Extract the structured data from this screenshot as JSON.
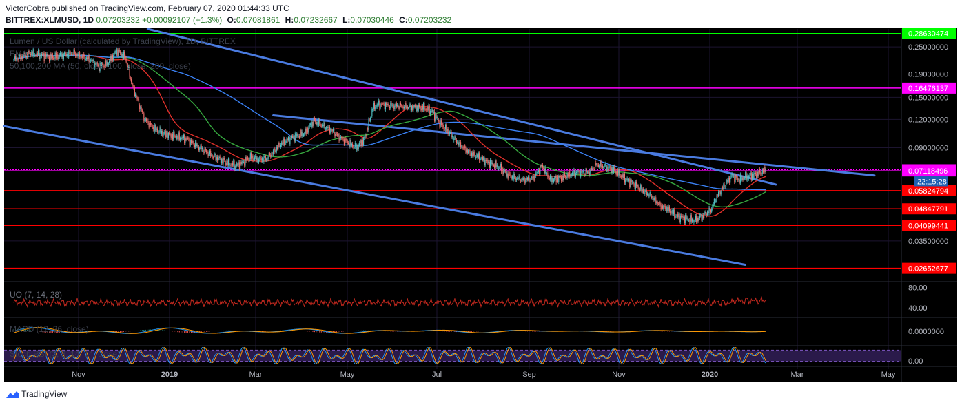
{
  "header": {
    "line1": "VictorCobra published on TradingView.com, February 07, 2020 01:44:33 UTC",
    "symbol": "BITTREX:XLMUSD, 1D",
    "price": "0.07203232",
    "change": "+0.00092107 (+1.3%)",
    "o_label": "O:",
    "o": "0.07081861",
    "h_label": "H:",
    "h": "0.07232667",
    "l_label": "L:",
    "l": "0.07030446",
    "c_label": "C:",
    "c": "0.07203232"
  },
  "legend": {
    "main": "Lumen / US Dollar (calculated by TradingView), 1D, BITTREX",
    "emas": "EMA",
    "mas": "50,100,200 MA (50, close, 100, close, 200, close)",
    "uo": "UO (7, 14, 28)",
    "macd": "MACD (12, 26, close)",
    "stoch": "Stoch RSI (3, 3, 14, 14, close)"
  },
  "footer": {
    "brand": "TradingView"
  },
  "colors": {
    "bg": "#000000",
    "grid": "#1c1430",
    "axis_text": "#b2b5be",
    "candle_up": "#4fc1c4",
    "candle_down": "#ef6f6c",
    "trendline": "#4a7be0",
    "ma50": "#e0302a",
    "ma100": "#36a83f",
    "ma200": "#3b82f6",
    "level_green": "#00ff00",
    "level_magenta": "#ff00ff",
    "level_red": "#ff0000"
  },
  "chart_data": [
    {
      "type": "candlestick",
      "title": "Lumen / US Dollar (calculated by TradingView), 1D, BITTREX",
      "scale": "log",
      "ylim": [
        0.0235,
        0.3
      ],
      "x_tick_labels": [
        "Nov",
        "2019",
        "Mar",
        "May",
        "Jul",
        "Sep",
        "Nov",
        "2020",
        "Mar",
        "May"
      ],
      "y_tick_labels": [
        0.25,
        0.19,
        0.15,
        0.12,
        0.09,
        0.05824794,
        0.035,
        0.02652677
      ],
      "close_path": [
        [
          0,
          0.22
        ],
        [
          20,
          0.235
        ],
        [
          45,
          0.225
        ],
        [
          70,
          0.235
        ],
        [
          90,
          0.22
        ],
        [
          100,
          0.205
        ],
        [
          110,
          0.21
        ],
        [
          122,
          0.24
        ],
        [
          132,
          0.225
        ],
        [
          140,
          0.17
        ],
        [
          148,
          0.14
        ],
        [
          155,
          0.12
        ],
        [
          165,
          0.11
        ],
        [
          175,
          0.105
        ],
        [
          185,
          0.102
        ],
        [
          205,
          0.098
        ],
        [
          220,
          0.09
        ],
        [
          235,
          0.083
        ],
        [
          250,
          0.078
        ],
        [
          262,
          0.075
        ],
        [
          270,
          0.077
        ],
        [
          280,
          0.082
        ],
        [
          290,
          0.08
        ],
        [
          300,
          0.081
        ],
        [
          315,
          0.093
        ],
        [
          330,
          0.1
        ],
        [
          345,
          0.105
        ],
        [
          355,
          0.118
        ],
        [
          365,
          0.113
        ],
        [
          375,
          0.108
        ],
        [
          385,
          0.1
        ],
        [
          395,
          0.095
        ],
        [
          405,
          0.09
        ],
        [
          415,
          0.098
        ],
        [
          425,
          0.135
        ],
        [
          432,
          0.14
        ],
        [
          445,
          0.138
        ],
        [
          460,
          0.137
        ],
        [
          475,
          0.135
        ],
        [
          485,
          0.135
        ],
        [
          495,
          0.13
        ],
        [
          505,
          0.115
        ],
        [
          515,
          0.105
        ],
        [
          525,
          0.095
        ],
        [
          540,
          0.085
        ],
        [
          550,
          0.082
        ],
        [
          560,
          0.078
        ],
        [
          575,
          0.074
        ],
        [
          585,
          0.068
        ],
        [
          595,
          0.066
        ],
        [
          605,
          0.065
        ],
        [
          615,
          0.066
        ],
        [
          625,
          0.075
        ],
        [
          635,
          0.065
        ],
        [
          645,
          0.066
        ],
        [
          655,
          0.068
        ],
        [
          665,
          0.07
        ],
        [
          680,
          0.07
        ],
        [
          690,
          0.076
        ],
        [
          700,
          0.074
        ],
        [
          710,
          0.072
        ],
        [
          725,
          0.065
        ],
        [
          735,
          0.062
        ],
        [
          745,
          0.058
        ],
        [
          755,
          0.055
        ],
        [
          765,
          0.05
        ],
        [
          775,
          0.048
        ],
        [
          785,
          0.045
        ],
        [
          795,
          0.044
        ],
        [
          805,
          0.043
        ],
        [
          815,
          0.045
        ],
        [
          825,
          0.048
        ],
        [
          832,
          0.055
        ],
        [
          842,
          0.062
        ],
        [
          850,
          0.068
        ],
        [
          858,
          0.065
        ],
        [
          866,
          0.067
        ],
        [
          874,
          0.068
        ],
        [
          884,
          0.07
        ],
        [
          890,
          0.07203232
        ]
      ],
      "overlay_levels": [
        {
          "value": 0.28630474,
          "label": "0.28630474",
          "color": "level_green"
        },
        {
          "value": 0.16476137,
          "label": "0.16476137",
          "color": "level_magenta"
        },
        {
          "value": 0.07203232,
          "label": "0.07203232",
          "color": "level_magenta",
          "style": "dotted"
        },
        {
          "value": 0.07118496,
          "label": "0.07118496",
          "color": "level_magenta"
        },
        {
          "value": 0.05824794,
          "label": "0.05824794",
          "color": "level_red"
        },
        {
          "value": 0.04847791,
          "label": "0.04847791",
          "color": "level_red"
        },
        {
          "value": 0.04099441,
          "label": "0.04099441",
          "color": "level_red"
        },
        {
          "value": 0.02652677,
          "label": "0.02652677",
          "color": "level_red"
        }
      ],
      "countdown": "22:15:28",
      "trendlines": [
        {
          "from": [
            0.16,
            0.3
          ],
          "to": [
            0.86,
            0.062
          ]
        },
        {
          "from": [
            0,
            0.112
          ],
          "to": [
            0.826,
            0.0275
          ]
        },
        {
          "from": [
            0.3,
            0.125
          ],
          "to": [
            0.97,
            0.068
          ]
        }
      ]
    },
    {
      "type": "line",
      "title": "UO (7, 14, 28)",
      "ylim": [
        25,
        90
      ],
      "y_tick_labels": [
        80.0,
        40.0
      ],
      "current": 55
    },
    {
      "type": "line",
      "title": "MACD (12, 26, close)",
      "y_tick_labels": [
        "0.0000000"
      ]
    },
    {
      "type": "line",
      "title": "Stoch RSI (3, 3, 14, 14, close)",
      "ylim": [
        0,
        100
      ],
      "y_tick_labels": [
        0.0
      ],
      "bands": [
        20,
        80
      ]
    }
  ]
}
